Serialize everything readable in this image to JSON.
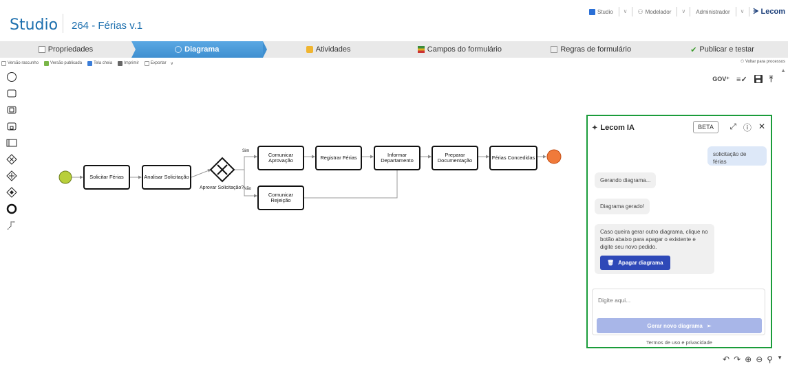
{
  "header": {
    "logo": "Studio",
    "process_title": "264 - Férias v.1",
    "top_items": [
      {
        "label": "Studio",
        "icon": "grid-icon"
      },
      {
        "label": "Modelador",
        "icon": "user-icon"
      },
      {
        "label": "Administrador"
      }
    ],
    "brand": "ᗒ Lecom"
  },
  "tabs": [
    {
      "label": "Propriedades",
      "icon": "document-icon",
      "active": false
    },
    {
      "label": "Diagrama",
      "icon": "diagram-icon",
      "active": true
    },
    {
      "label": "Atividades",
      "icon": "activities-icon",
      "active": false
    },
    {
      "label": "Campos do formulário",
      "icon": "fields-icon",
      "active": false
    },
    {
      "label": "Regras de formulário",
      "icon": "rules-icon",
      "active": false
    },
    {
      "label": "Publicar e testar",
      "icon": "check-icon",
      "active": false
    }
  ],
  "toolbar": {
    "versao_rascunho": "Versão rascunho",
    "versao_publicada": "Versão publicada",
    "tela_cheia": "Tela cheia",
    "imprimir": "Imprimir",
    "exportar": "Exportar",
    "voltar": "Voltar para processos"
  },
  "canvas_tools": {
    "gov": "GOV⁺"
  },
  "diagram": {
    "tasks": {
      "solicitar": "Solicitar Férias",
      "analisar": "Analisar Solicitação",
      "comunicar_aprov": "Comunicar Aprovação",
      "registrar": "Registrar Férias",
      "informar": "Informar Departamento",
      "preparar": "Preparar Documentação",
      "concedidas": "Férias Concedidas",
      "comunicar_rej": "Comunicar Rejeição"
    },
    "gateway_label": "Aprovar Solicitação?",
    "yes_label": "Sim",
    "no_label": "Não"
  },
  "ai_panel": {
    "title": "Lecom IA",
    "beta": "BETA",
    "user_msg": "solicitação de férias",
    "msg1": "Gerando diagrama...",
    "msg2": "Diagrama gerado!",
    "msg3": "Caso queira gerar outro diagrama, clique no botão abaixo para apagar o existente e digite seu novo pedido.",
    "delete_button": "Apagar diagrama",
    "input_placeholder": "Digite aqui...",
    "generate_button": "Gerar novo diagrama",
    "terms": "Termos de uso e privacidade"
  },
  "colors": {
    "accent": "#3f8fd0",
    "panel_border": "#1a9c3a",
    "start_event": "#b8cf3a",
    "end_event": "#f07a3a",
    "primary_button": "#2e49b8"
  }
}
